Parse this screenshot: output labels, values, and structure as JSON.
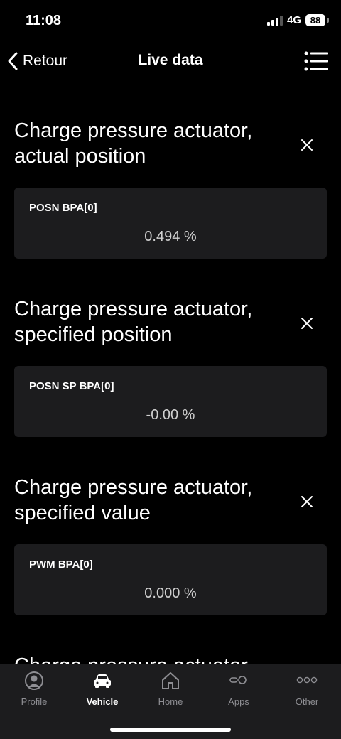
{
  "status_bar": {
    "time": "11:08",
    "network": "4G",
    "battery": "88"
  },
  "nav": {
    "back_label": "Retour",
    "title": "Live data"
  },
  "sections": [
    {
      "title": "Charge pressure actuator, actual position",
      "label": "POSN BPA[0]",
      "value": "0.494 %"
    },
    {
      "title": "Charge pressure actuator, specified position",
      "label": "POSN SP BPA[0]",
      "value": "-0.00 %"
    },
    {
      "title": "Charge pressure actuator, specified value",
      "label": "PWM BPA[0]",
      "value": "0.000 %"
    },
    {
      "title": "Charge pressure actuator"
    }
  ],
  "tabs": [
    {
      "label": "Profile",
      "icon": "profile-icon",
      "active": false
    },
    {
      "label": "Vehicle",
      "icon": "car-icon",
      "active": true
    },
    {
      "label": "Home",
      "icon": "home-icon",
      "active": false
    },
    {
      "label": "Apps",
      "icon": "apps-icon",
      "active": false
    },
    {
      "label": "Other",
      "icon": "more-icon",
      "active": false
    }
  ]
}
